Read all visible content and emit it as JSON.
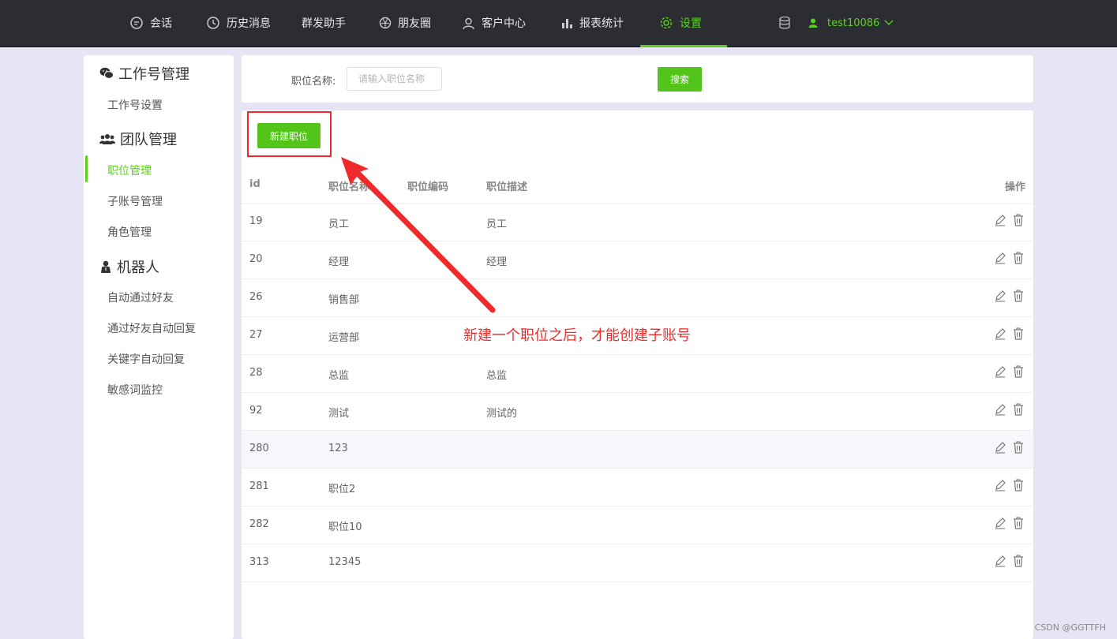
{
  "nav": {
    "items": [
      {
        "label": "会话",
        "icon": "chat-bubble-icon"
      },
      {
        "label": "历史消息",
        "icon": "clock-icon"
      },
      {
        "label": "群发助手",
        "icon": ""
      },
      {
        "label": "朋友圈",
        "icon": "aperture-icon"
      },
      {
        "label": "客户中心",
        "icon": "user-outline-icon"
      },
      {
        "label": "报表统计",
        "icon": "bar-chart-icon"
      },
      {
        "label": "设置",
        "icon": "gear-icon",
        "active": true
      }
    ],
    "username": "test10086",
    "accent": "#5bd11d"
  },
  "sidebar": {
    "groups": [
      {
        "title": "工作号管理",
        "icon": "wechat-icon",
        "items": [
          "工作号设置"
        ]
      },
      {
        "title": "团队管理",
        "icon": "team-icon",
        "items": [
          "职位管理",
          "子账号管理",
          "角色管理"
        ]
      },
      {
        "title": "机器人",
        "icon": "robot-icon",
        "items": [
          "自动通过好友",
          "通过好友自动回复",
          "关键字自动回复",
          "敏感词监控"
        ]
      }
    ],
    "active_item": "职位管理"
  },
  "search": {
    "label": "职位名称:",
    "placeholder": "请输入职位名称",
    "value": "",
    "button": "搜索"
  },
  "toolbar": {
    "new_button": "新建职位"
  },
  "table": {
    "columns": [
      "id",
      "职位名称",
      "职位编码",
      "职位描述",
      "操作"
    ],
    "rows": [
      {
        "id": "19",
        "name": "员工",
        "code": "",
        "desc": "员工"
      },
      {
        "id": "20",
        "name": "经理",
        "code": "",
        "desc": "经理"
      },
      {
        "id": "26",
        "name": "销售部",
        "code": "",
        "desc": ""
      },
      {
        "id": "27",
        "name": "运营部",
        "code": "",
        "desc": ""
      },
      {
        "id": "28",
        "name": "总监",
        "code": "",
        "desc": "总监"
      },
      {
        "id": "92",
        "name": "测试",
        "code": "",
        "desc": "测试的"
      },
      {
        "id": "280",
        "name": "123",
        "code": "",
        "desc": ""
      },
      {
        "id": "281",
        "name": "职位2",
        "code": "",
        "desc": ""
      },
      {
        "id": "282",
        "name": "职位10",
        "code": "",
        "desc": ""
      },
      {
        "id": "313",
        "name": "12345",
        "code": "",
        "desc": ""
      }
    ]
  },
  "annotation": {
    "text": "新建一个职位之后，才能创建子账号",
    "color": "#f02a2a"
  },
  "watermark": "CSDN @GGTTFH"
}
